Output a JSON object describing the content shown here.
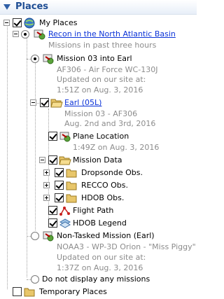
{
  "panel": {
    "title": "Places"
  },
  "tree": {
    "my_places": "My Places",
    "recon": {
      "title": "Recon in the North Atlantic Basin",
      "subtitle": "Missions in past three hours"
    },
    "mission03": {
      "title": "Mission 03 into Earl",
      "line1": "AF306 - Air Force WC-130J",
      "line2": "Updated on our site at:",
      "line3": "1:51Z on Aug. 3, 2016"
    },
    "earl": {
      "title": "Earl (05L)",
      "line1": "Mission 03 - AF306",
      "line2": "Aug. 2nd and 3rd, 2016"
    },
    "plane_location": {
      "title": "Plane Location",
      "time": "1:49Z on Aug. 3, 2016"
    },
    "mission_data": {
      "title": "Mission Data",
      "items": [
        "Dropsonde Obs.",
        "RECCO Obs.",
        "HDOB Obs."
      ]
    },
    "flight_path": "Flight Path",
    "hdob_legend": "HDOB Legend",
    "non_tasked": {
      "title": "Non-Tasked Mission (Earl)",
      "line1": "NOAA3 - WP-3D Orion - \"Miss Piggy\"",
      "line2": "Updated on our site at:",
      "line3": "1:37Z on Aug. 3, 2016"
    },
    "no_display": "Do not display any missions",
    "temporary": "Temporary Places"
  },
  "colors": {
    "accent": "#1f4e94",
    "link": "#0b33d8",
    "muted": "#8c8c8c",
    "folder": "#e8c66a"
  }
}
